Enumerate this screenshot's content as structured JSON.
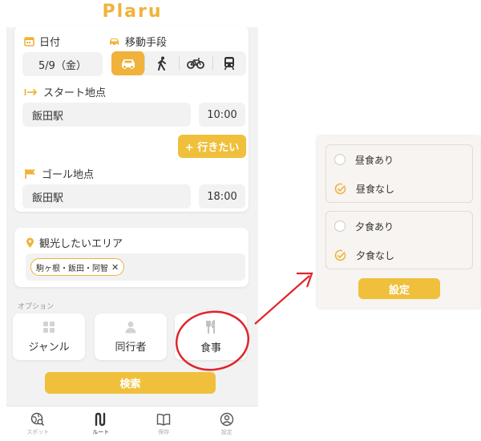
{
  "app": {
    "logo": "Plaru"
  },
  "route": {
    "date_label": "日付",
    "date_value": "5/9（金）",
    "transport_label": "移動手段",
    "transport_options": [
      "car-icon",
      "walk-icon",
      "bicycle-icon",
      "train-icon"
    ],
    "transport_selected": "car-icon",
    "start_label": "スタート地点",
    "start_place": "飯田駅",
    "start_time": "10:00",
    "add_stop_label": "+ 行きたい",
    "goal_label": "ゴール地点",
    "goal_place": "飯田駅",
    "goal_time": "18:00"
  },
  "area": {
    "label": "観光したいエリア",
    "chips": [
      {
        "text": "駒ヶ根・飯田・阿智",
        "remove": "✕"
      }
    ]
  },
  "options": {
    "header": "オプション",
    "items": [
      {
        "label": "ジャンル",
        "icon": "grid-icon"
      },
      {
        "label": "同行者",
        "icon": "person-icon"
      },
      {
        "label": "食事",
        "icon": "cutlery-icon"
      }
    ],
    "highlighted": "食事"
  },
  "search_button": "検索",
  "tabbar": {
    "items": [
      {
        "label": "スポット",
        "icon": "globe-search-icon",
        "active": false
      },
      {
        "label": "ルート",
        "icon": "route-icon",
        "active": true
      },
      {
        "label": "保存",
        "icon": "book-icon",
        "active": false
      },
      {
        "label": "設定",
        "icon": "user-circle-icon",
        "active": false
      }
    ]
  },
  "meal_modal": {
    "lunch_options": [
      {
        "label": "昼食あり",
        "checked": false
      },
      {
        "label": "昼食なし",
        "checked": true
      }
    ],
    "dinner_options": [
      {
        "label": "夕食あり",
        "checked": false
      },
      {
        "label": "夕食なし",
        "checked": true
      }
    ],
    "submit_label": "設定"
  },
  "colors": {
    "accent": "#f0b23a",
    "button": "#f0c03c",
    "annotation": "#e0252b",
    "background": "#f2f2f2"
  }
}
